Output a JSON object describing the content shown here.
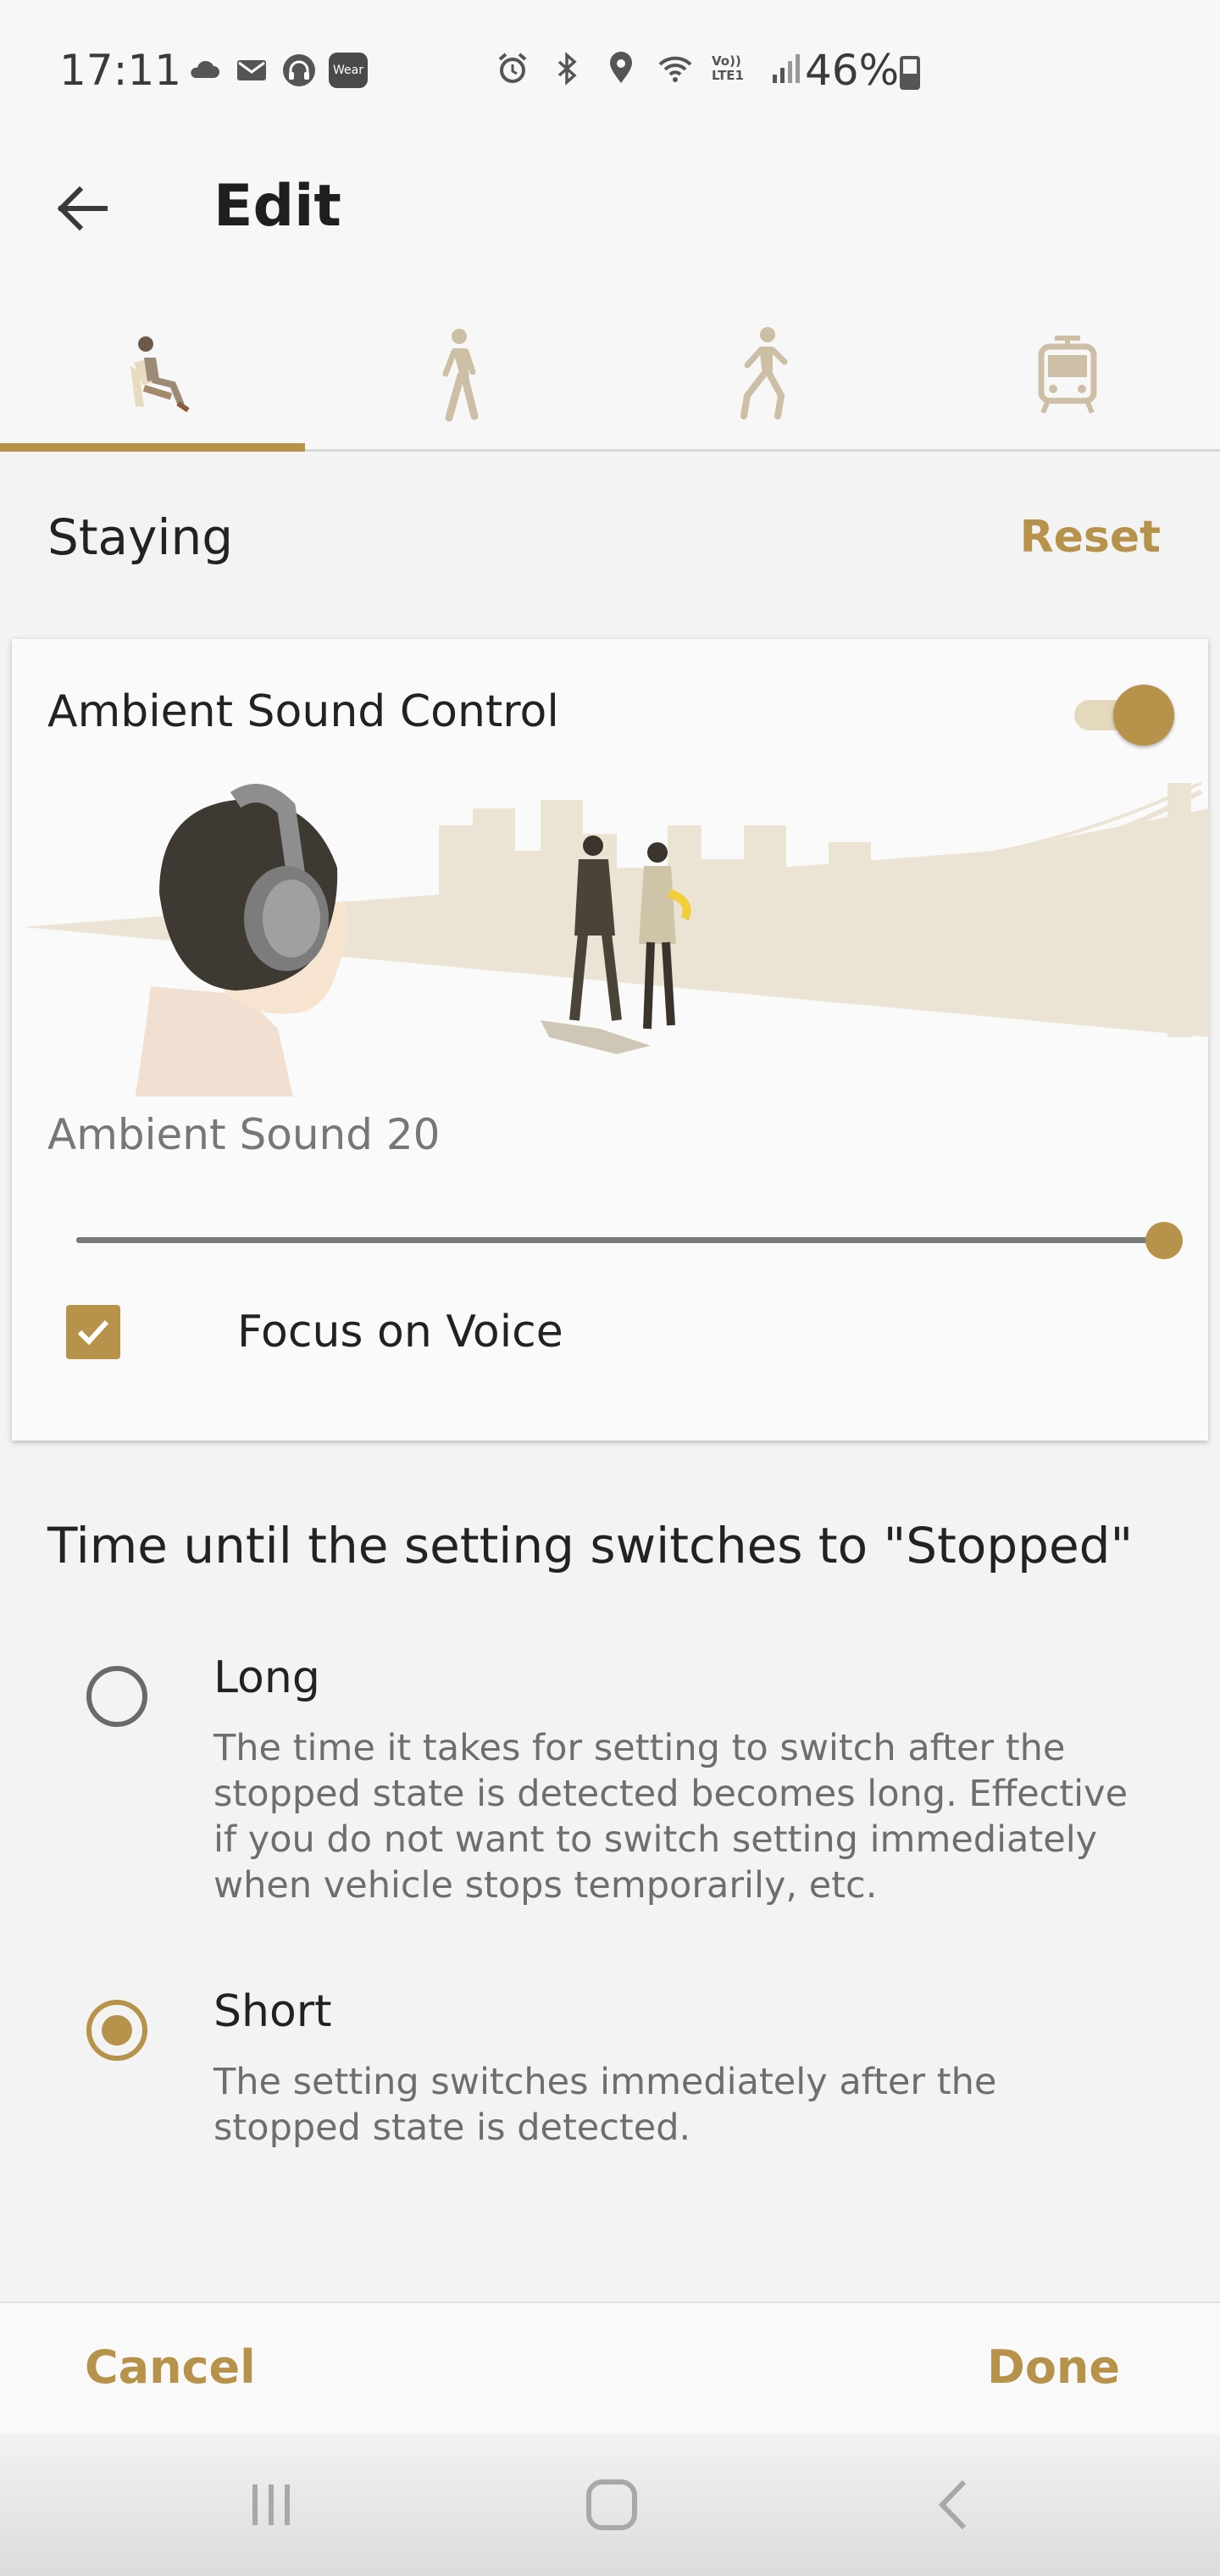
{
  "status_bar": {
    "time": "17:11",
    "battery_percent": "46%",
    "left_icons": [
      "cloud-icon",
      "mail-icon",
      "headphones-icon",
      "wear-icon"
    ],
    "wear_label": "Wear",
    "right_icons": [
      "alarm-icon",
      "bluetooth-icon",
      "location-icon",
      "wifi-icon",
      "volte-icon",
      "signal-icon",
      "battery-icon"
    ],
    "volte_label": "Vo)) LTE1"
  },
  "appbar": {
    "title": "Edit",
    "back_icon": "arrow-left-icon"
  },
  "tabs": [
    {
      "name": "staying-tab",
      "icon": "sitting-person-icon",
      "active": true
    },
    {
      "name": "walking-tab",
      "icon": "walking-person-icon",
      "active": false
    },
    {
      "name": "running-tab",
      "icon": "running-person-icon",
      "active": false
    },
    {
      "name": "transport-tab",
      "icon": "tram-icon",
      "active": false
    }
  ],
  "section": {
    "title": "Staying",
    "reset_label": "Reset"
  },
  "ambient_card": {
    "title": "Ambient Sound Control",
    "toggle_on": true,
    "ambient_label": "Ambient Sound 20",
    "ambient_level": 20,
    "ambient_max": 20,
    "focus_on_voice_label": "Focus on Voice",
    "focus_on_voice_checked": true
  },
  "time_section": {
    "title": "Time until the setting switches to \"Stopped\"",
    "options": [
      {
        "label": "Long",
        "description": "The time it takes for setting to switch after the stopped state is detected becomes long. Effective if you do not want to switch setting immediately when vehicle stops temporarily, etc.",
        "selected": false
      },
      {
        "label": "Short",
        "description": "The setting switches immediately after the stopped state is detected.",
        "selected": true
      }
    ]
  },
  "actions": {
    "cancel_label": "Cancel",
    "done_label": "Done"
  },
  "navigation": {
    "icons": [
      "recent-apps-icon",
      "home-icon",
      "back-icon"
    ]
  },
  "colors": {
    "accent": "#b6924a",
    "background": "#f3f3f3",
    "card": "#fafafa"
  }
}
